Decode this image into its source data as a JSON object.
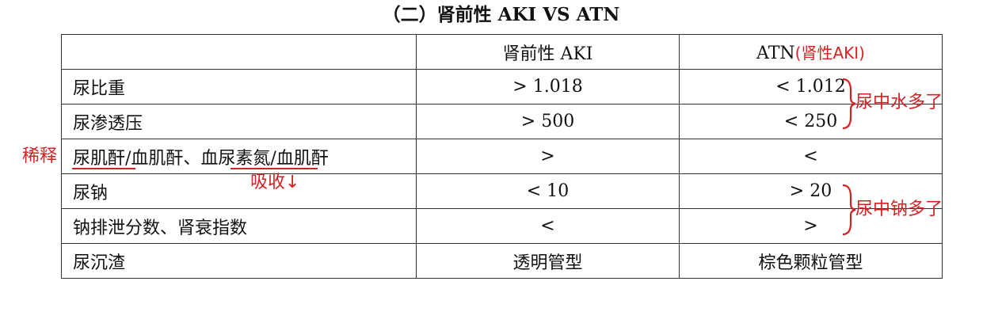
{
  "title": "（二）肾前性 AKI VS ATN",
  "table": {
    "header": [
      "",
      "肾前性 AKI",
      "ATN"
    ],
    "rows": [
      [
        "尿比重",
        "> 1.018",
        "< 1.012"
      ],
      [
        "尿渗透压",
        "> 500",
        "< 250"
      ],
      [
        "尿肌酐/血肌酐、血尿素氮/血肌酐",
        ">",
        "<"
      ],
      [
        "尿钠",
        "< 10",
        "> 20"
      ],
      [
        "钠排泄分数、肾衰指数",
        "<",
        ">"
      ],
      [
        "尿沉渣",
        "透明管型",
        "棕色颗粒管型"
      ]
    ]
  },
  "annotations": {
    "atn_note": "(肾性AKI)",
    "dilute": "稀释",
    "absorb": "吸收↓",
    "urine_water": "尿中水多了",
    "urine_sodium": "尿中钠多了"
  },
  "colors": {
    "annotation": "#d42222",
    "grid": "#333333"
  }
}
